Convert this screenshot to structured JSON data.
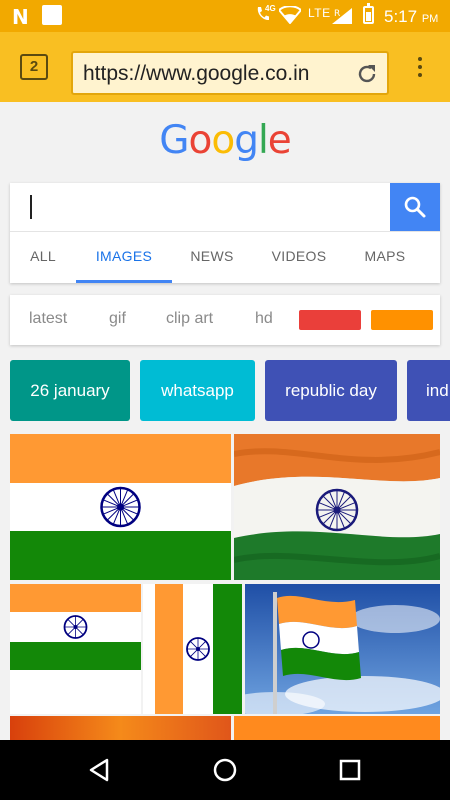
{
  "status_bar": {
    "app_letter": "N",
    "network_type": "4G",
    "lte_label": "LTE",
    "roaming": "R",
    "time": "5:17",
    "ampm": "PM",
    "bg_color": "#F2A900"
  },
  "browser": {
    "tab_count": "2",
    "url": "https://www.google.co.in",
    "toolbar_color": "#F9BF22"
  },
  "google": {
    "logo_letters": [
      "G",
      "o",
      "o",
      "g",
      "l",
      "e"
    ],
    "logo_colors": [
      "#4285F4",
      "#EA4335",
      "#FBBC05",
      "#4285F4",
      "#34A853",
      "#EA4335"
    ]
  },
  "search": {
    "value": "",
    "tabs": [
      "ALL",
      "IMAGES",
      "NEWS",
      "VIDEOS",
      "MAPS"
    ],
    "active_tab": "IMAGES",
    "button_color": "#4285F4"
  },
  "filters": {
    "labels": [
      "latest",
      "gif",
      "clip art",
      "hd"
    ],
    "color_chips": [
      "#EA3F3A",
      "#FF9100"
    ]
  },
  "suggestions": [
    {
      "label": "26 january",
      "color": "#009688"
    },
    {
      "label": "whatsapp",
      "color": "#00BCD4"
    },
    {
      "label": "republic day",
      "color": "#3F51B5"
    },
    {
      "label": "ind",
      "color": "#3F51B5"
    }
  ],
  "images": [
    {
      "alt": "indian-flag-flat"
    },
    {
      "alt": "indian-flag-waving"
    },
    {
      "alt": "indian-flag-horizontal-small"
    },
    {
      "alt": "indian-flag-vertical"
    },
    {
      "alt": "indian-flag-on-pole-sky"
    },
    {
      "alt": "fire-image"
    },
    {
      "alt": "orange-image"
    }
  ],
  "flag_colors": {
    "saffron": "#FF9933",
    "white": "#FFFFFF",
    "green": "#138808",
    "chakra": "#000080"
  }
}
